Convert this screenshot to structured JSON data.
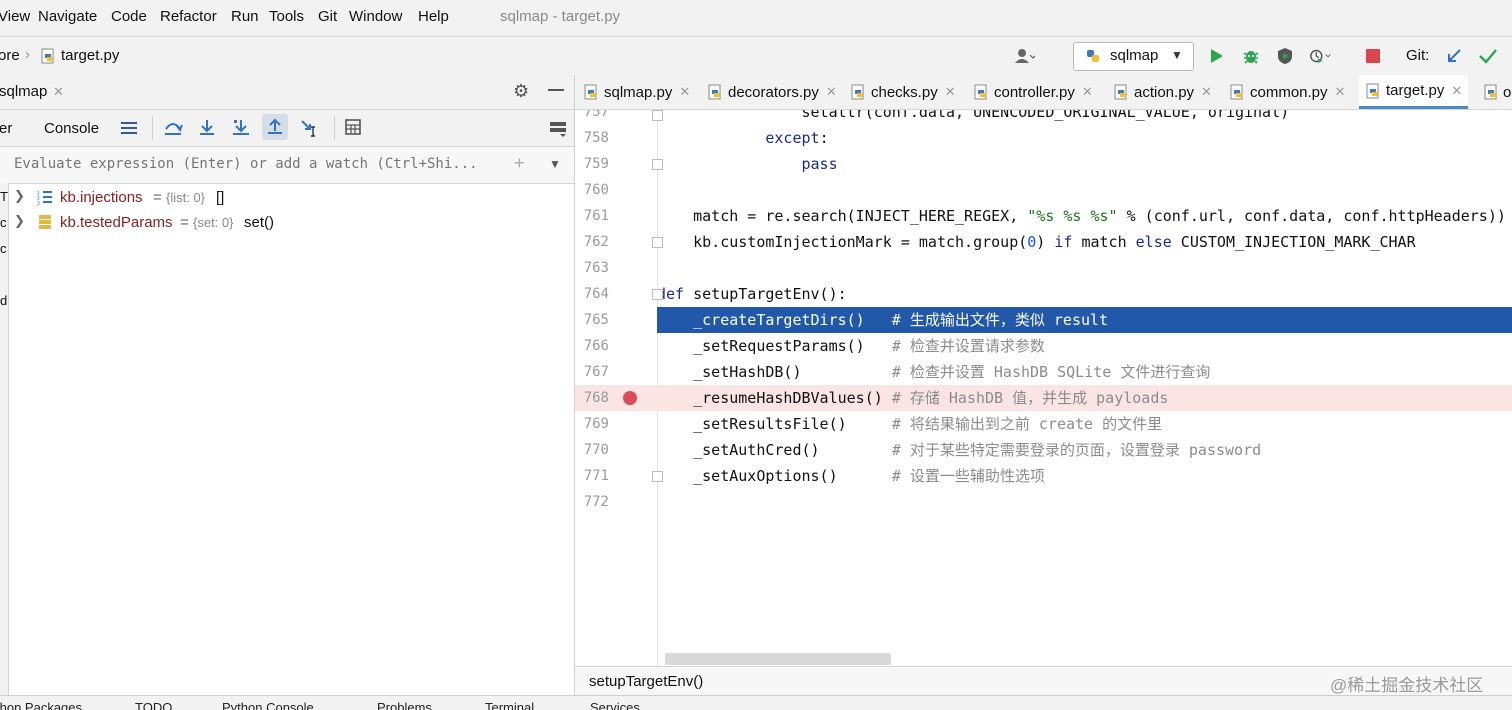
{
  "menu": {
    "items": [
      "View",
      "Navigate",
      "Code",
      "Refactor",
      "Run",
      "Tools",
      "Git",
      "Window",
      "Help"
    ],
    "title": "sqlmap - target.py"
  },
  "nav": {
    "crumb_parent": "ore",
    "crumb_file": "target.py",
    "run_config": "sqlmap",
    "git_label": "Git:"
  },
  "debug": {
    "tab_label": "sqlmap",
    "tab_debugger": "er",
    "tab_console": "Console",
    "watch_placeholder": "Evaluate expression (Enter) or add a watch (Ctrl+Shi...",
    "variables": [
      {
        "name": "kb.injections",
        "type": "{list: 0}",
        "value": "[]"
      },
      {
        "name": "kb.testedParams",
        "type": "{set: 0}",
        "value": "set()"
      }
    ]
  },
  "editor": {
    "tabs": [
      "sqlmap.py",
      "decorators.py",
      "checks.py",
      "controller.py",
      "action.py",
      "common.py",
      "target.py",
      "o"
    ],
    "active_tab": "target.py",
    "breadcrumb": "setupTargetEnv()",
    "highlighted_line": 765,
    "breakpoint_line": 768
  },
  "status_bar": {
    "items": [
      "thon Packages",
      "TODO",
      "Python Console",
      "Problems",
      "Terminal",
      "Services"
    ]
  },
  "watermark": "@稀土掘金技术社区",
  "colors": {
    "selection": "#2158a9",
    "breakpoint_line_bg": "#fbe4e4",
    "breakpoint_dot": "#db4c5a",
    "run_green": "#2ea44f",
    "stop_red": "#d9464d"
  }
}
